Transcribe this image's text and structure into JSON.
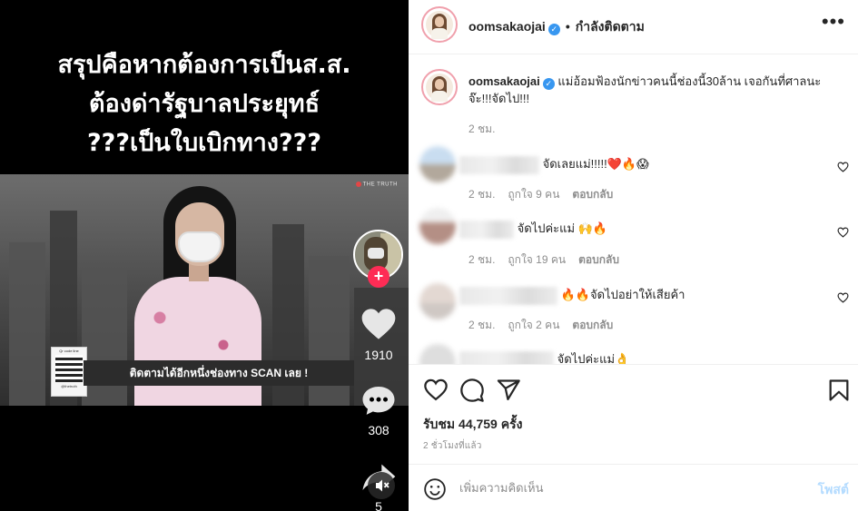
{
  "video": {
    "caption_lines": [
      "สรุปคือหากต้องการเป็นส.ส.",
      "ต้องด่ารัฐบาลประยุทธ์",
      "???เป็นใบเบิกทาง???"
    ],
    "watermark": "THE TRUTH",
    "banner_text": "ติดตามได้อีกหนึ่งช่องทาง SCAN เลย !",
    "qr_header": "Qr code line",
    "qr_footer": "@thetruth",
    "likes": "1910",
    "comments": "308",
    "shares": "5",
    "follow_symbol": "+"
  },
  "post": {
    "username": "oomsakaojai",
    "follow_state": "กำลังติดตาม",
    "caption": "แม่อ้อมฟ้องนักข่าวคนนี้ช่องนี้30ล้าน เจอกันที่ศาลนะจ๊ะ!!!จัดไป!!!",
    "caption_time": "2 ชม.",
    "verified_glyph": "✓"
  },
  "comments": [
    {
      "text": "จัดเลยแม่!!!!!❤️🔥😱",
      "time": "2 ชม.",
      "likes": "ถูกใจ 9 คน",
      "reply": "ตอบกลับ"
    },
    {
      "text": "จัดไปค่ะแม่ 🙌🔥",
      "time": "2 ชม.",
      "likes": "ถูกใจ 19 คน",
      "reply": "ตอบกลับ"
    },
    {
      "text": "🔥🔥จัดไปอย่าให้เสียค้า",
      "time": "2 ชม.",
      "likes": "ถูกใจ 2 คน",
      "reply": "ตอบกลับ"
    },
    {
      "text": "จัดไปค่ะแม่👌",
      "time": "",
      "likes": "",
      "reply": ""
    }
  ],
  "actions": {
    "likes": "รับชม 44,759 ครั้ง",
    "time_ago": "2 ชั่วโมงที่แล้ว"
  },
  "composer": {
    "placeholder": "เพิ่มความคิดเห็น",
    "post_label": "โพสต์"
  },
  "colors": {
    "accent": "#3897f0",
    "post_disabled": "#b3dbff",
    "tiktok_red": "#fe2c55"
  },
  "icons": [
    "heart-icon",
    "comment-icon",
    "share-icon",
    "bookmark-icon",
    "emoji-icon",
    "more-icon",
    "mute-icon"
  ]
}
